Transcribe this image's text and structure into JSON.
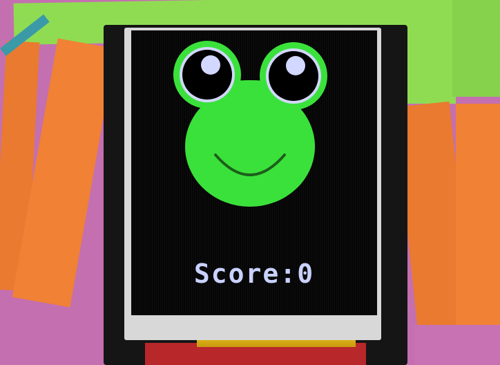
{
  "game": {
    "score_label": "Score",
    "score_separator": ":",
    "score_value": "0"
  },
  "colors": {
    "frog_green": "#3be13b",
    "frog_dark": "#1c5e1c",
    "eye_rim": "#d2d8ff",
    "pupil": "#000000",
    "highlight": "#d2d8ff",
    "screen_bg": "#050505",
    "score_text": "#c9d2ff"
  },
  "icons": [
    "frog-face-icon"
  ]
}
